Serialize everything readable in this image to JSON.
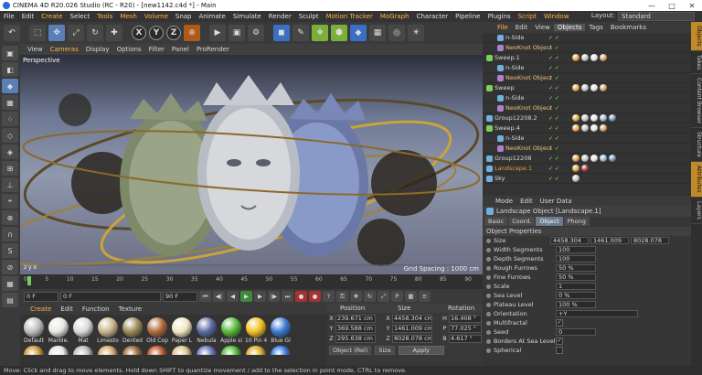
{
  "window": {
    "title": "CINEMA 4D R20.026 Studio (RC - R20) - [new1142.c4d *] - Main",
    "min": "—",
    "max": "□",
    "close": "✕"
  },
  "menu": {
    "items": [
      "File",
      "Edit",
      "Create",
      "Select",
      "Tools",
      "Mesh",
      "Volume",
      "Snap",
      "Animate",
      "Simulate",
      "Render",
      "Sculpt",
      "Motion Tracker",
      "MoGraph",
      "Character",
      "Pipeline",
      "Plugins",
      "Script",
      "Window"
    ],
    "layout_label": "Layout:",
    "layout_value": "Standard"
  },
  "toolbar": {
    "undo": "↶",
    "live_select": "⬚",
    "move": "✥",
    "scale": "⤢",
    "rotate": "↻",
    "add": "✚",
    "x": "X",
    "y": "Y",
    "z": "Z",
    "coord": "⊕",
    "render_view": "▶",
    "render_region": "▣",
    "render_settings": "⚙",
    "cube": "◼",
    "pen": "✎",
    "subdiv": "❖",
    "array": "⬢",
    "deform": "◆",
    "floor": "▦",
    "camera": "◎",
    "light": "☀"
  },
  "viewport": {
    "menu": [
      "View",
      "Cameras",
      "Display",
      "Options",
      "Filter",
      "Panel",
      "ProRender"
    ],
    "label": "Perspective",
    "grid_spacing": "Grid Spacing : 1000 cm",
    "axes": "z  y  x"
  },
  "timeline": {
    "ticks": [
      "0",
      "5",
      "10",
      "15",
      "20",
      "25",
      "30",
      "35",
      "40",
      "45",
      "50",
      "55",
      "60",
      "65",
      "70",
      "75",
      "80",
      "85",
      "90"
    ],
    "current_frame": "0 F"
  },
  "playback": {
    "start": "0 F",
    "current": "0 F",
    "end_min": "90 F",
    "end": "90 F",
    "first": "⏮",
    "prev_key": "◀|",
    "prev": "◀",
    "play": "▶",
    "next": "▶",
    "next_key": "|▶",
    "last": "⏭",
    "rec": "●",
    "auto": "●",
    "keysel": "?",
    "keyall": "⚿",
    "pos": "✥",
    "rot": "↻",
    "scl": "⤢",
    "param": "P",
    "pla": "▦",
    "menu": "≡"
  },
  "materials": {
    "menu": [
      "Create",
      "Edit",
      "Function",
      "Texture"
    ],
    "items": [
      {
        "label": "Default",
        "color": "#bdbdbd"
      },
      {
        "label": "Marble.",
        "color": "#e8e6e0"
      },
      {
        "label": "Mat",
        "color": "#d9d9d9"
      },
      {
        "label": "Limesto",
        "color": "#c9b48a"
      },
      {
        "label": "Dented",
        "color": "#9a8a5a"
      },
      {
        "label": "Old Cop",
        "color": "#b06a3a"
      },
      {
        "label": "Paper L",
        "color": "#f0e6c0"
      },
      {
        "label": "Nebula",
        "color": "#5a6aa0"
      },
      {
        "label": "Apple si",
        "color": "#5ab83a"
      },
      {
        "label": "10 Pin 4",
        "color": "#f0c020"
      },
      {
        "label": "Blue Gl",
        "color": "#3a7ad0"
      }
    ],
    "row2_colors": [
      "#d0a040",
      "#e8e8e8",
      "#c0c0c0",
      "#d8b070",
      "#a07040",
      "#c06030",
      "#e0c890",
      "#7080c0",
      "#60c040",
      "#e0b030",
      "#4080e0"
    ]
  },
  "coordinates": {
    "headers": {
      "position": "Position",
      "size": "Size",
      "rotation": "Rotation"
    },
    "rows": [
      {
        "axis": "X",
        "pos": "239.671 cm",
        "size_axis": "X",
        "size": "4458.304 cm",
        "rot_axis": "H",
        "rot": "16.408 °"
      },
      {
        "axis": "Y",
        "pos": "369.588 cm",
        "size_axis": "Y",
        "size": "1461.009 cm",
        "rot_axis": "P",
        "rot": "77.025 °"
      },
      {
        "axis": "Z",
        "pos": "295.638 cm",
        "size_axis": "Z",
        "size": "8028.078 cm",
        "rot_axis": "B",
        "rot": "4.617 °"
      }
    ],
    "mode": "Object (Rel)",
    "size_mode": "Size",
    "apply": "Apply"
  },
  "status": "Move: Click and drag to move elements. Hold down SHIFT to quantize movement / add to the selection in point mode, CTRL to remove.",
  "objects": {
    "menu": [
      "File",
      "Edit",
      "View",
      "Objects",
      "Tags",
      "Bookmarks"
    ],
    "rows": [
      {
        "name": "n-Side",
        "indent": 2,
        "style": "plain",
        "icon": "#6fb0e0",
        "tags": []
      },
      {
        "name": "NeoKnot Object",
        "indent": 2,
        "style": "plain",
        "icon": "#b080d0",
        "tags": []
      },
      {
        "name": "Sweep.1",
        "indent": 0,
        "style": "plain",
        "icon": "#7ad05a",
        "tags": [
          "#e0a040",
          "#c0c0c0",
          "#e0e0e0",
          "#d0a060"
        ]
      },
      {
        "name": "n-Side",
        "indent": 2,
        "style": "plain",
        "icon": "#6fb0e0",
        "tags": []
      },
      {
        "name": "NeoKnot Object",
        "indent": 2,
        "style": "plain",
        "icon": "#b080d0",
        "tags": []
      },
      {
        "name": "Sweep",
        "indent": 0,
        "style": "plain",
        "icon": "#7ad05a",
        "tags": [
          "#e0a040",
          "#c0c0c0",
          "#e0e0e0",
          "#d0a060"
        ]
      },
      {
        "name": "n-Side",
        "indent": 2,
        "style": "plain",
        "icon": "#6fb0e0",
        "tags": []
      },
      {
        "name": "NeoKnot Object",
        "indent": 2,
        "style": "plain",
        "icon": "#b080d0",
        "tags": []
      },
      {
        "name": "Group12208.2",
        "indent": 0,
        "style": "plain",
        "icon": "#6fb0e0",
        "tags": [
          "#e0a040",
          "#c0c0c0",
          "#e0e0e0",
          "#9ab0d0",
          "#6a8ab0"
        ]
      },
      {
        "name": "Sweep.4",
        "indent": 0,
        "style": "plain",
        "icon": "#7ad05a",
        "tags": [
          "#e0a040",
          "#c0c0c0",
          "#e0e0e0",
          "#d0a060"
        ]
      },
      {
        "name": "n-Side",
        "indent": 2,
        "style": "plain",
        "icon": "#6fb0e0",
        "tags": []
      },
      {
        "name": "NeoKnot Object",
        "indent": 2,
        "style": "plain",
        "icon": "#b080d0",
        "tags": []
      },
      {
        "name": "Group12208",
        "indent": 0,
        "style": "plain",
        "icon": "#6fb0e0",
        "tags": [
          "#e0a040",
          "#c0c0c0",
          "#e0e0e0",
          "#9ab0d0",
          "#6a8ab0"
        ]
      },
      {
        "name": "Landscape.1",
        "indent": 0,
        "style": "orange",
        "icon": "#6fb0e0",
        "tags": [
          "#e0a040",
          "#a03030"
        ]
      },
      {
        "name": "Sky",
        "indent": 0,
        "style": "plain",
        "icon": "#6fb0e0",
        "tags": [
          "#c0c0c0"
        ]
      }
    ],
    "flags": "✓ ✓"
  },
  "attributes": {
    "menu": [
      "Mode",
      "Edit",
      "User Data"
    ],
    "title": "Landscape Object [Landscape.1]",
    "tabs": [
      "Basic",
      "Coord.",
      "Object",
      "Phong"
    ],
    "selected_tab": 2,
    "section": "Object Properties",
    "size_label": "Size",
    "size_values": [
      "4458.304",
      "1461.009",
      "8028.078"
    ],
    "rows": [
      {
        "label": "Width Segments",
        "value": "100"
      },
      {
        "label": "Depth Segments",
        "value": "100"
      },
      {
        "label": "Rough Furrows",
        "value": "50 %"
      },
      {
        "label": "Fine Furrows",
        "value": "50 %"
      },
      {
        "label": "Scale",
        "value": "1"
      },
      {
        "label": "Sea Level",
        "value": "0 %"
      },
      {
        "label": "Plateau Level",
        "value": "100 %"
      },
      {
        "label": "Orientation",
        "value": "+Y"
      },
      {
        "label": "Multifractal",
        "value": "✓"
      },
      {
        "label": "Seed",
        "value": "0"
      },
      {
        "label": "Borders At Sea Level",
        "value": "✓"
      },
      {
        "label": "Spherical",
        "value": ""
      }
    ]
  },
  "side_tabs": [
    "Objects",
    "Takes",
    "Content Browser",
    "Structure",
    "Attributes",
    "Layers"
  ]
}
